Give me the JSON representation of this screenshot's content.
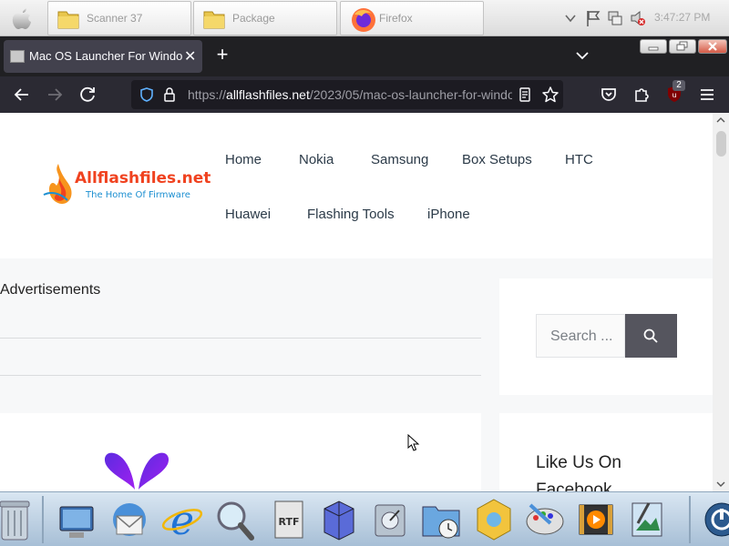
{
  "os_taskbar": {
    "tasks": [
      {
        "label": "Scanner 37"
      },
      {
        "label": "Package"
      },
      {
        "label": "Firefox"
      }
    ],
    "clock": "3:47:27 PM"
  },
  "browser": {
    "tab": {
      "title": "Mac OS Launcher For Windows"
    },
    "url": {
      "scheme": "https://",
      "host": "allflashfiles.net",
      "path": "/2023/05/mac-os-launcher-for-windo"
    },
    "extension_badge": "2"
  },
  "site": {
    "logo": {
      "main": "Allflashfiles.net",
      "tagline": "The Home Of Firmware"
    },
    "menu": [
      "Home",
      "Nokia",
      "Samsung",
      "Box Setups",
      "HTC",
      "Huawei",
      "Flashing Tools",
      "iPhone"
    ]
  },
  "content": {
    "ads_label": "Advertisements"
  },
  "sidebar": {
    "search_placeholder": "Search ...",
    "widget_title": "Like Us On Facebook"
  },
  "colors": {
    "browser_chrome": "#2b2a33",
    "tab_bar": "#202023",
    "active_tab": "#42414d",
    "logo_red": "#f0421f",
    "logo_blue": "#1c8fd1",
    "search_button": "#55555e"
  }
}
